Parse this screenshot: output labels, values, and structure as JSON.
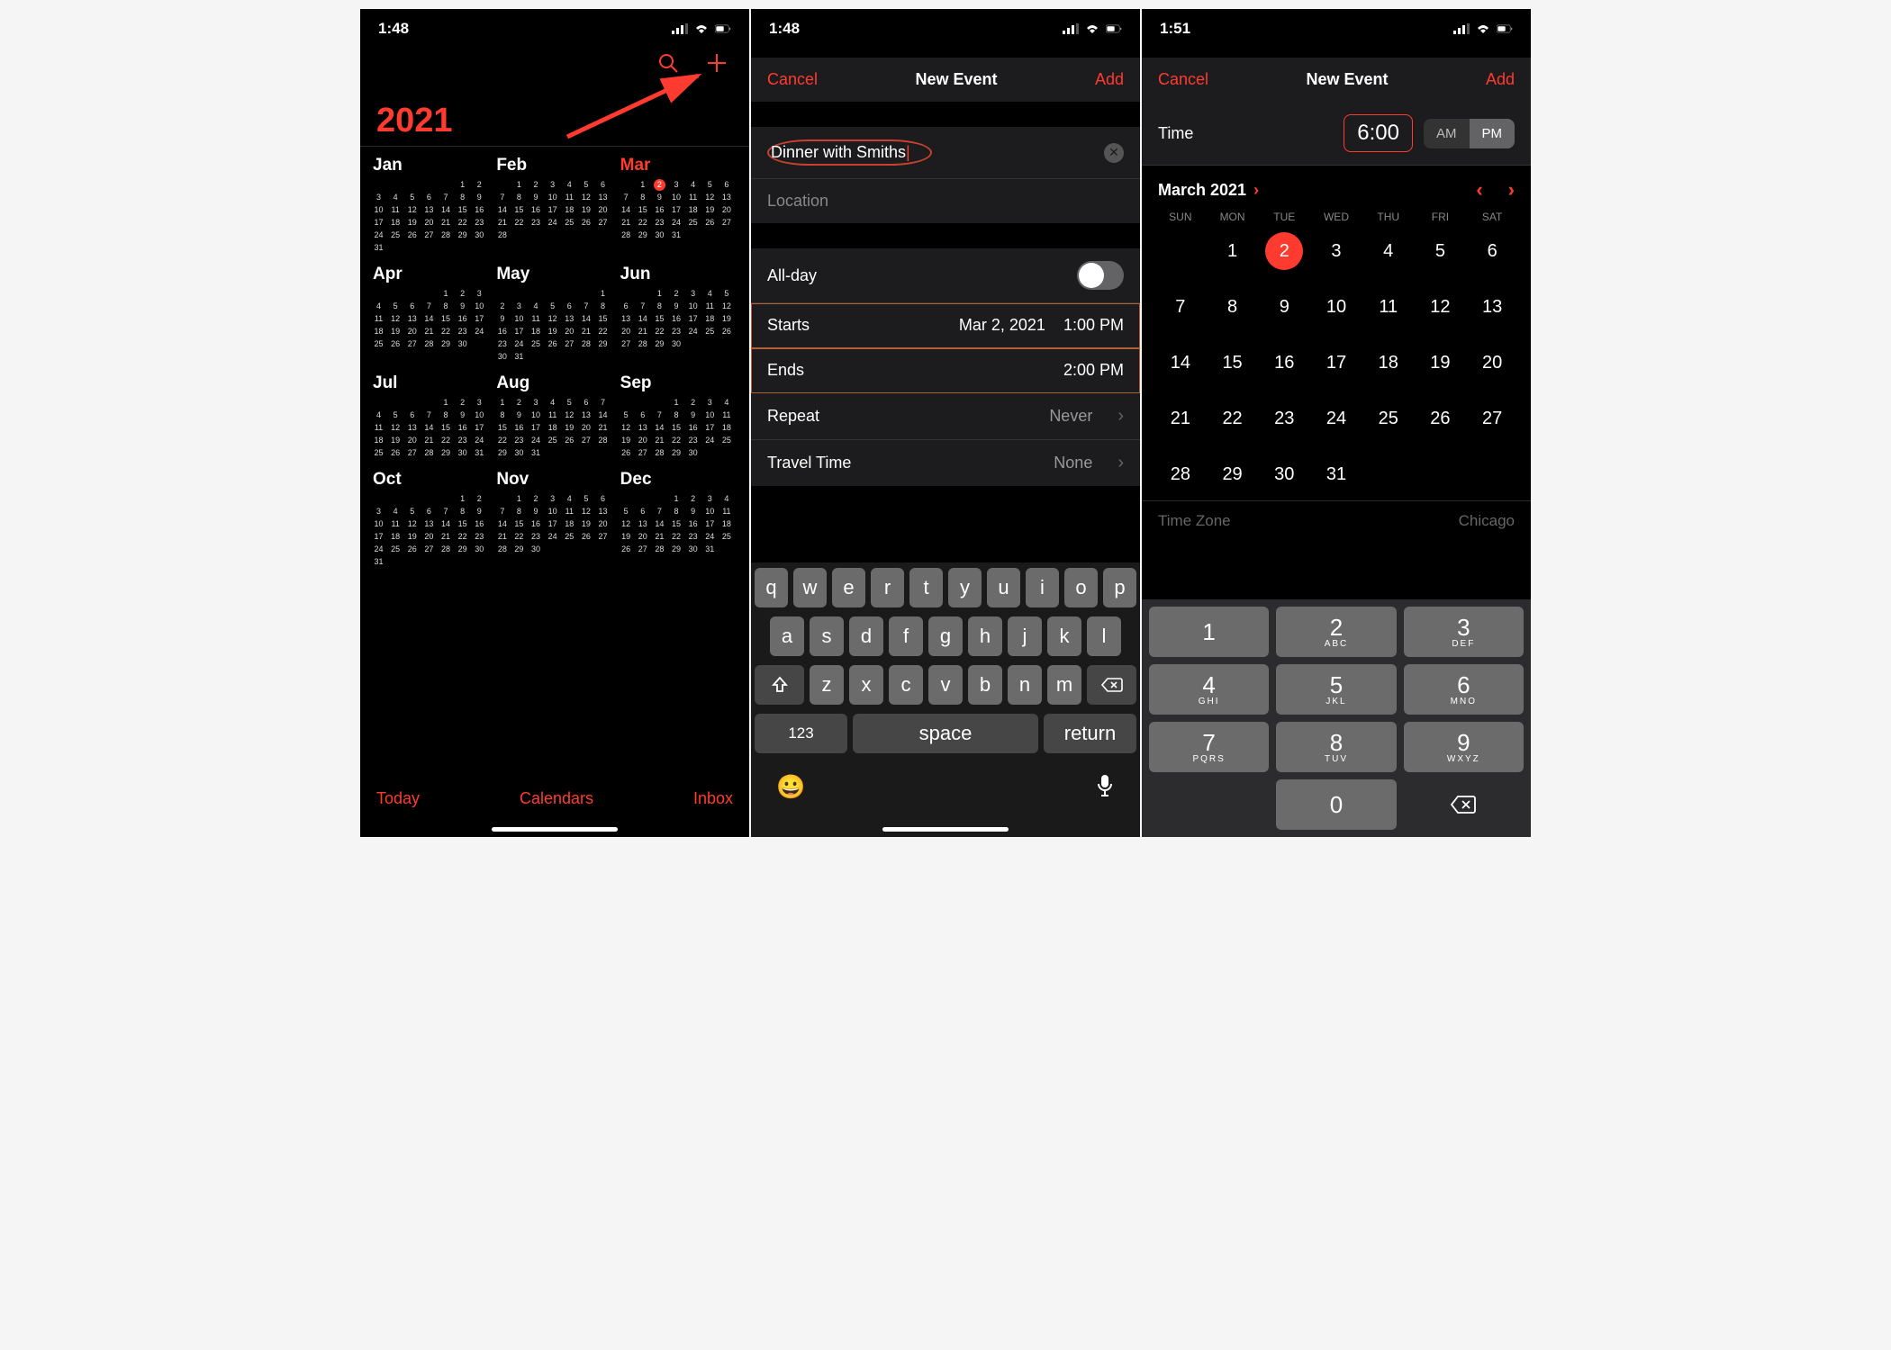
{
  "status_time1": "1:48",
  "status_time2": "1:48",
  "status_time3": "1:51",
  "accent": "#ff3b30",
  "screen1": {
    "year": "2021",
    "today_button": "Today",
    "calendars_button": "Calendars",
    "inbox_button": "Inbox",
    "current_month": "Mar",
    "today_date": 2,
    "months": [
      {
        "label": "Jan",
        "days": 31,
        "start": 5
      },
      {
        "label": "Feb",
        "days": 28,
        "start": 1
      },
      {
        "label": "Mar",
        "days": 31,
        "start": 1
      },
      {
        "label": "Apr",
        "days": 30,
        "start": 4
      },
      {
        "label": "May",
        "days": 31,
        "start": 6
      },
      {
        "label": "Jun",
        "days": 30,
        "start": 2
      },
      {
        "label": "Jul",
        "days": 31,
        "start": 4
      },
      {
        "label": "Aug",
        "days": 31,
        "start": 0
      },
      {
        "label": "Sep",
        "days": 30,
        "start": 3
      },
      {
        "label": "Oct",
        "days": 31,
        "start": 5
      },
      {
        "label": "Nov",
        "days": 30,
        "start": 1
      },
      {
        "label": "Dec",
        "days": 31,
        "start": 3
      }
    ]
  },
  "screen2": {
    "cancel": "Cancel",
    "title": "New Event",
    "add": "Add",
    "event_title": "Dinner with Smiths",
    "location_placeholder": "Location",
    "allday_label": "All-day",
    "allday_value": false,
    "starts_label": "Starts",
    "starts_date": "Mar 2, 2021",
    "starts_time": "1:00 PM",
    "ends_label": "Ends",
    "ends_time": "2:00 PM",
    "repeat_label": "Repeat",
    "repeat_value": "Never",
    "travel_label": "Travel Time",
    "travel_value": "None",
    "keyboard_space": "space",
    "keyboard_return": "return",
    "keyboard_123": "123",
    "kb_rows": [
      [
        "q",
        "w",
        "e",
        "r",
        "t",
        "y",
        "u",
        "i",
        "o",
        "p"
      ],
      [
        "a",
        "s",
        "d",
        "f",
        "g",
        "h",
        "j",
        "k",
        "l"
      ],
      [
        "z",
        "x",
        "c",
        "v",
        "b",
        "n",
        "m"
      ]
    ]
  },
  "screen3": {
    "cancel": "Cancel",
    "title": "New Event",
    "add": "Add",
    "time_label": "Time",
    "time_value": "6:00",
    "am": "AM",
    "pm": "PM",
    "ampm_selected": "PM",
    "month_label": "March 2021",
    "dow": [
      "SUN",
      "MON",
      "TUE",
      "WED",
      "THU",
      "FRI",
      "SAT"
    ],
    "selected_date": 2,
    "days_in_month": 31,
    "start_offset": 1,
    "tz_label": "Time Zone",
    "tz_value": "Chicago",
    "numpad": [
      {
        "d": "1",
        "l": ""
      },
      {
        "d": "2",
        "l": "ABC"
      },
      {
        "d": "3",
        "l": "DEF"
      },
      {
        "d": "4",
        "l": "GHI"
      },
      {
        "d": "5",
        "l": "JKL"
      },
      {
        "d": "6",
        "l": "MNO"
      },
      {
        "d": "7",
        "l": "PQRS"
      },
      {
        "d": "8",
        "l": "TUV"
      },
      {
        "d": "9",
        "l": "WXYZ"
      },
      {
        "d": "",
        "l": ""
      },
      {
        "d": "0",
        "l": ""
      },
      {
        "d": "⌫",
        "l": ""
      }
    ]
  }
}
